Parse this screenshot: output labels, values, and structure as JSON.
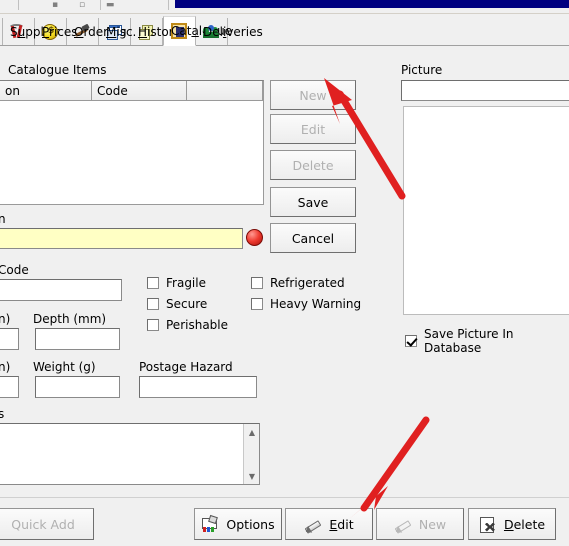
{
  "window": {
    "accent_navy": "#000080",
    "bg": "#f0f0f0"
  },
  "tabs": [
    {
      "label": "Supplier",
      "accel": "u",
      "icon": "supplier-icon",
      "active": false
    },
    {
      "label": "Prices",
      "accel": "P",
      "icon": "coin-icon",
      "active": false
    },
    {
      "label": "Ordering",
      "accel": "O",
      "icon": "hammer-icon",
      "active": false
    },
    {
      "label": "Misc.",
      "accel": "M",
      "icon": "windows-icon",
      "active": false
    },
    {
      "label": "History",
      "accel": "H",
      "icon": "copy-icon",
      "active": false
    },
    {
      "label": "Catalogue",
      "accel": "a",
      "icon": "picture-frame-icon",
      "active": true
    },
    {
      "label": "Deliveries",
      "accel": "i",
      "icon": "people-icon",
      "active": false
    }
  ],
  "catalogue": {
    "group_title": "Catalogue Items",
    "columns": [
      "on",
      "Code",
      ""
    ],
    "rows": [],
    "side_buttons": [
      {
        "label": "New",
        "enabled": false
      },
      {
        "label": "Edit",
        "enabled": false
      },
      {
        "label": "Delete",
        "enabled": false
      },
      {
        "label": "Save",
        "enabled": true
      },
      {
        "label": "Cancel",
        "enabled": true
      }
    ]
  },
  "picture": {
    "group_title": "Picture",
    "path_value": "",
    "save_in_db": {
      "label": "Save Picture In Database",
      "checked": true
    }
  },
  "form": {
    "description_label": "n",
    "description_value": "",
    "required_indicator": "red-dot",
    "code_label": "Code",
    "code_value": "",
    "fields": [
      {
        "label": "n)",
        "value": ""
      },
      {
        "label": "Depth (mm)",
        "value": ""
      },
      {
        "label": "n)",
        "value": ""
      },
      {
        "label": "Weight (g)",
        "value": ""
      },
      {
        "label": "Postage Hazard",
        "value": ""
      }
    ],
    "checkboxes": [
      {
        "label": "Fragile",
        "checked": false
      },
      {
        "label": "Secure",
        "checked": false
      },
      {
        "label": "Perishable",
        "checked": false
      },
      {
        "label": "Refrigerated",
        "checked": false
      },
      {
        "label": "Heavy Warning",
        "checked": false
      }
    ],
    "notes_label": "s",
    "notes_value": ""
  },
  "bottom_toolbar": [
    {
      "label": "Quick Add",
      "accel": "Q",
      "icon": "none",
      "enabled": false
    },
    {
      "label": "Options",
      "accel": "",
      "icon": "options-icon",
      "enabled": true
    },
    {
      "label": "Edit",
      "accel": "E",
      "icon": "pencil-icon",
      "enabled": true
    },
    {
      "label": "New",
      "accel": "N",
      "icon": "pencil-icon",
      "enabled": false
    },
    {
      "label": "Delete",
      "accel": "D",
      "icon": "trash-icon",
      "enabled": true
    }
  ],
  "annotations": {
    "arrow_color": "#e02020",
    "arrows": [
      {
        "name": "arrow-to-new-button",
        "points_to": "New"
      },
      {
        "name": "arrow-to-edit-button",
        "points_to": "Edit"
      }
    ]
  }
}
